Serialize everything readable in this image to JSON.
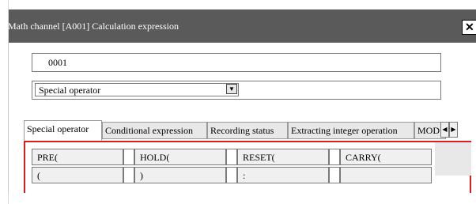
{
  "window": {
    "title": "Math channel [A001] Calculation expression",
    "close_glyph": "✕"
  },
  "channel_field": {
    "value": "0001"
  },
  "operator_select": {
    "selected": "Special operator",
    "arrow": "▼"
  },
  "tabs": [
    {
      "label": "Special operator"
    },
    {
      "label": "Conditional expression"
    },
    {
      "label": "Recording status"
    },
    {
      "label": "Extracting integer operation"
    },
    {
      "label": "MOD"
    }
  ],
  "tab_scroll": {
    "left": "◀",
    "right": "▶"
  },
  "operators": {
    "row1": [
      "PRE(",
      "HOLD(",
      "RESET(",
      "CARRY("
    ],
    "row2": [
      "(",
      ")",
      ":",
      ""
    ]
  }
}
